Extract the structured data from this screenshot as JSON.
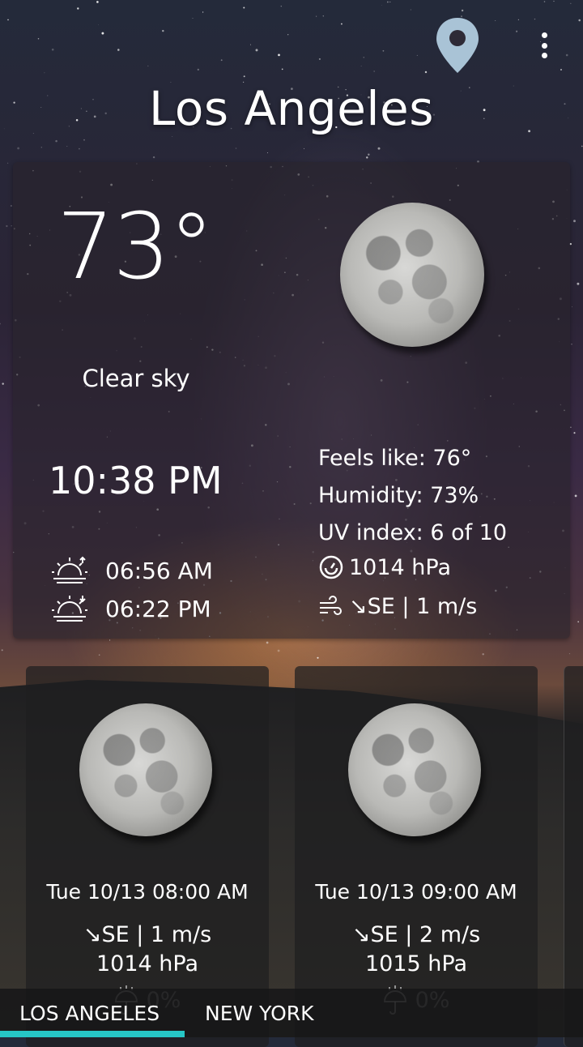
{
  "city": "Los Angeles",
  "current": {
    "temperature": "73°",
    "condition": "Clear sky",
    "time": "10:38 PM",
    "sunrise": "06:56 AM",
    "sunset": "06:22 PM",
    "feels_like": "Feels like: 76°",
    "humidity": "Humidity: 73%",
    "uv_index": "UV index: 6 of 10",
    "pressure": "1014 hPa",
    "wind": "↘SE | 1 m/s"
  },
  "forecast": [
    {
      "datetime": "Tue 10/13 08:00 AM",
      "wind": "↘SE | 1 m/s",
      "pressure": "1014 hPa",
      "precip": "0%"
    },
    {
      "datetime": "Tue 10/13 09:00 AM",
      "wind": "↘SE | 2 m/s",
      "pressure": "1015 hPa",
      "precip": "0%"
    }
  ],
  "tabs": [
    "LOS ANGELES",
    "NEW YORK"
  ],
  "colors": {
    "accent": "#26c6c6",
    "pin": "#a9c3d6"
  },
  "icons": [
    "location-pin-icon",
    "more-vert-icon",
    "moon-icon",
    "sunrise-icon",
    "sunset-icon",
    "pressure-gauge-icon",
    "wind-icon",
    "umbrella-icon"
  ]
}
